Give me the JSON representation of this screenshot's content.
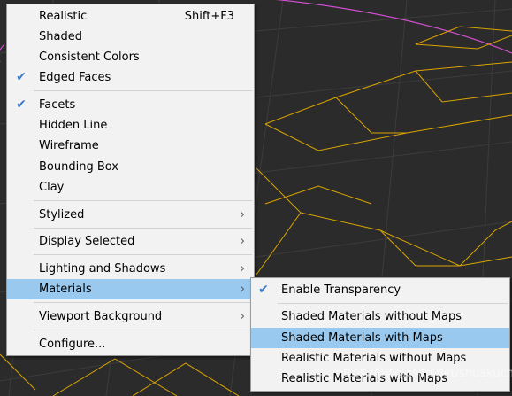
{
  "main_menu": {
    "realistic": {
      "label": "Realistic",
      "shortcut": "Shift+F3"
    },
    "shaded": {
      "label": "Shaded"
    },
    "consistent_colors": {
      "label": "Consistent Colors"
    },
    "edged_faces": {
      "label": "Edged Faces",
      "checked": true
    },
    "facets": {
      "label": "Facets",
      "checked": true
    },
    "hidden_line": {
      "label": "Hidden Line"
    },
    "wireframe": {
      "label": "Wireframe"
    },
    "bounding_box": {
      "label": "Bounding Box"
    },
    "clay": {
      "label": "Clay"
    },
    "stylized": {
      "label": "Stylized"
    },
    "display_selected": {
      "label": "Display Selected"
    },
    "lighting_and_shadows": {
      "label": "Lighting and Shadows"
    },
    "materials": {
      "label": "Materials",
      "highlighted": true
    },
    "viewport_background": {
      "label": "Viewport Background"
    },
    "configure": {
      "label": "Configure..."
    }
  },
  "materials_submenu": {
    "enable_transparency": {
      "label": "Enable Transparency",
      "checked": true
    },
    "shaded_without_maps": {
      "label": "Shaded Materials without Maps"
    },
    "shaded_with_maps": {
      "label": "Shaded Materials with Maps",
      "highlighted": true
    },
    "realistic_without_maps": {
      "label": "Realistic Materials without Maps"
    },
    "realistic_with_maps": {
      "label": "Realistic Materials with Maps"
    }
  },
  "icons": {
    "check": "✔",
    "arrow": "›"
  },
  "colors": {
    "menu_background": "#f2f2f2",
    "highlight": "#99c9ef",
    "check": "#3a79c9",
    "viewport_background": "#2b2b2b",
    "wireframe": "#d9a400",
    "viewport_circle": "#d04fd0"
  },
  "watermark": "https://blog.csdn.net/shuakucha"
}
